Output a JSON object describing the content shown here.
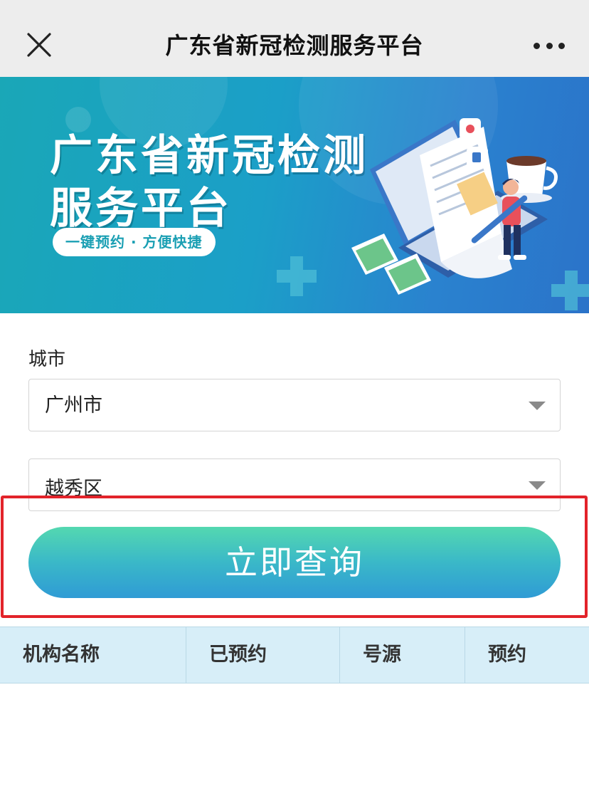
{
  "topbar": {
    "title": "广东省新冠检测服务平台",
    "close_icon": "close-icon",
    "more_icon": "more-dots-icon"
  },
  "banner": {
    "title_line1": "广东省新冠检测",
    "title_line2": "服务平台",
    "tagline": "一键预约 · 方便快捷"
  },
  "form": {
    "city_label": "城市",
    "city_value": "广州市",
    "district_value": "越秀区",
    "query_label": "立即查询"
  },
  "table": {
    "headers": [
      "机构名称",
      "已预约",
      "号源",
      "预约"
    ]
  },
  "colors": {
    "highlight": "#e2232a",
    "button_top": "#54d8b0",
    "button_bottom": "#2f9bd5",
    "table_header_bg": "#d7eef8"
  }
}
